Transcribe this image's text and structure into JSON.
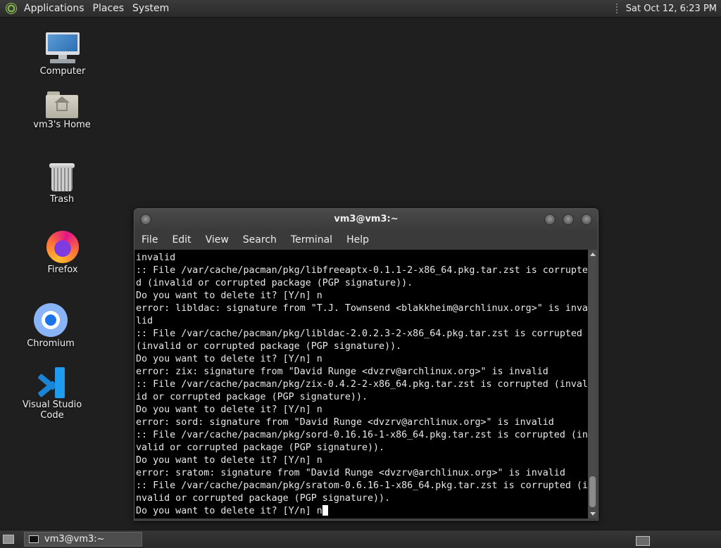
{
  "top_panel": {
    "menus": [
      "Applications",
      "Places",
      "System"
    ],
    "clock": "Sat Oct 12, 6:23 PM"
  },
  "desktop": {
    "icons": [
      {
        "label": "Computer",
        "icon": "computer-icon"
      },
      {
        "label": "vm3's Home",
        "icon": "home-folder-icon"
      },
      {
        "label": "Trash",
        "icon": "trash-icon"
      },
      {
        "label": "Firefox",
        "icon": "firefox-icon"
      },
      {
        "label": "Chromium",
        "icon": "chromium-icon"
      },
      {
        "label": "Visual Studio Code",
        "icon": "vscode-icon"
      }
    ]
  },
  "terminal": {
    "title": "vm3@vm3:~",
    "menu": [
      "File",
      "Edit",
      "View",
      "Search",
      "Terminal",
      "Help"
    ],
    "lines": [
      "invalid",
      ":: File /var/cache/pacman/pkg/libfreeaptx-0.1.1-2-x86_64.pkg.tar.zst is corrupte",
      "d (invalid or corrupted package (PGP signature)).",
      "Do you want to delete it? [Y/n] n",
      "error: libldac: signature from \"T.J. Townsend <blakkheim@archlinux.org>\" is inva",
      "lid",
      ":: File /var/cache/pacman/pkg/libldac-2.0.2.3-2-x86_64.pkg.tar.zst is corrupted",
      "(invalid or corrupted package (PGP signature)).",
      "Do you want to delete it? [Y/n] n",
      "error: zix: signature from \"David Runge <dvzrv@archlinux.org>\" is invalid",
      ":: File /var/cache/pacman/pkg/zix-0.4.2-2-x86_64.pkg.tar.zst is corrupted (inval",
      "id or corrupted package (PGP signature)).",
      "Do you want to delete it? [Y/n] n",
      "error: sord: signature from \"David Runge <dvzrv@archlinux.org>\" is invalid",
      ":: File /var/cache/pacman/pkg/sord-0.16.16-1-x86_64.pkg.tar.zst is corrupted (in",
      "valid or corrupted package (PGP signature)).",
      "Do you want to delete it? [Y/n] n",
      "error: sratom: signature from \"David Runge <dvzrv@archlinux.org>\" is invalid",
      ":: File /var/cache/pacman/pkg/sratom-0.6.16-1-x86_64.pkg.tar.zst is corrupted (i",
      "nvalid or corrupted package (PGP signature))."
    ],
    "prompt_line": "Do you want to delete it? [Y/n] n"
  },
  "taskbar": {
    "task_label": "vm3@vm3:~"
  }
}
